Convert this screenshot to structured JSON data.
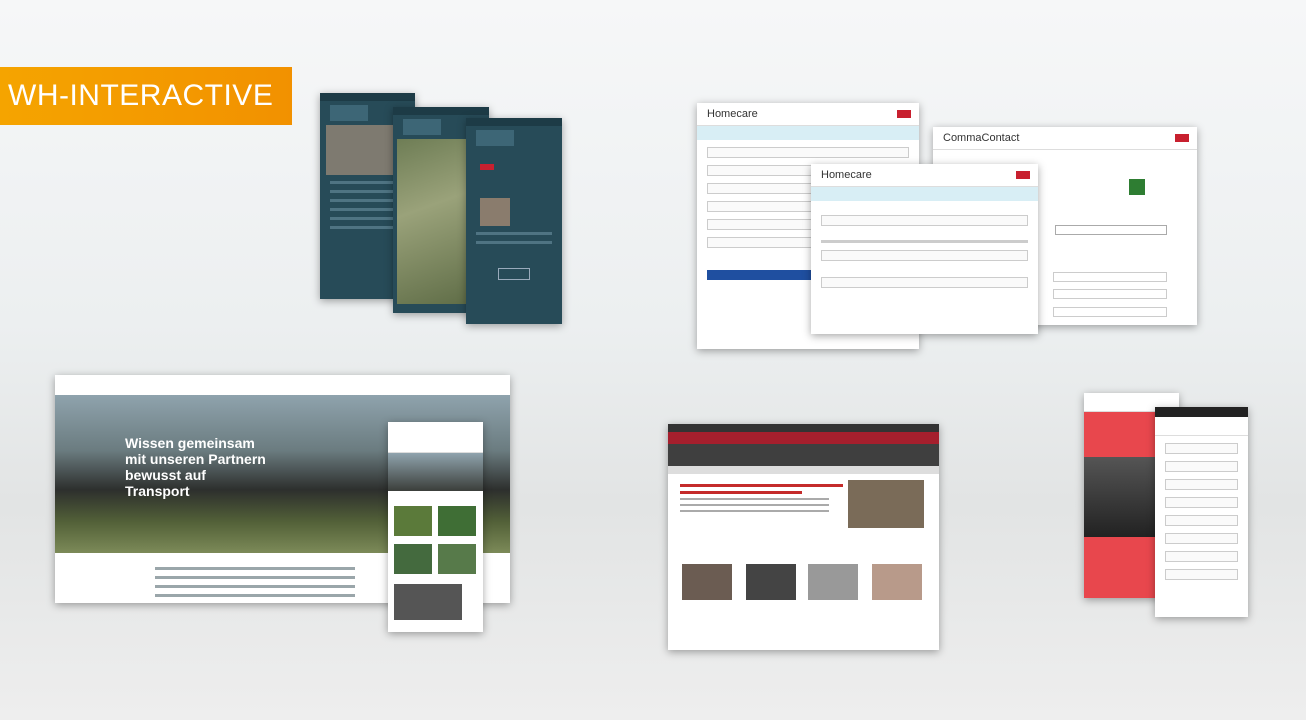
{
  "brand": {
    "label": "WH-INTERACTIVE",
    "color": "#f29100"
  },
  "forms": {
    "homecare_title": "Homecare",
    "homecare_small_title": "Homecare",
    "comma_title": "CommaContact"
  },
  "train_site": {
    "hero_line1": "Wissen gemeinsam",
    "hero_line2": "mit unseren Partnern",
    "hero_line3": "bewusst auf",
    "hero_line4": "Transport"
  }
}
